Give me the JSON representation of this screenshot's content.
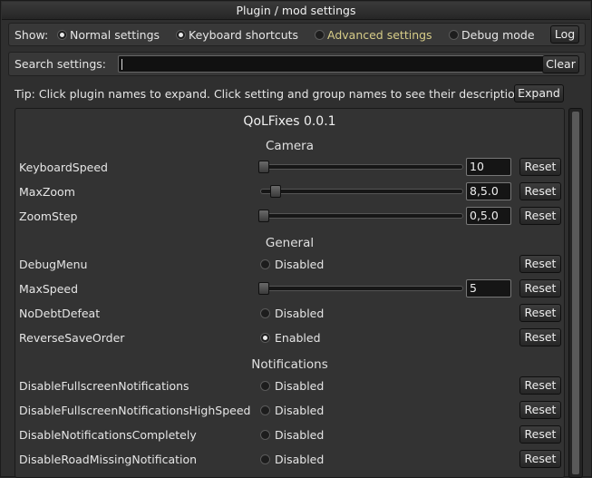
{
  "window": {
    "title": "Plugin / mod settings"
  },
  "filter": {
    "show_label": "Show:",
    "options": [
      {
        "label": "Normal settings",
        "selected": true
      },
      {
        "label": "Keyboard shortcuts",
        "selected": true
      },
      {
        "label": "Advanced settings",
        "selected": false
      },
      {
        "label": "Debug mode",
        "selected": false
      }
    ],
    "log_label": "Log"
  },
  "search": {
    "label": "Search settings:",
    "value": "",
    "clear_label": "Clear"
  },
  "tip": {
    "text": "Tip: Click plugin names to expand. Click setting and group names to see their descriptions.",
    "expand_label": "Expand"
  },
  "plugin": {
    "title": "QoLFixes 0.0.1",
    "reset_label": "Reset",
    "sections": [
      {
        "title": "Camera",
        "settings": [
          {
            "name": "KeyboardSpeed",
            "kind": "slider",
            "value": "10",
            "slider_fraction": 0.0
          },
          {
            "name": "MaxZoom",
            "kind": "slider",
            "value": "8,5.0",
            "slider_fraction": 0.06
          },
          {
            "name": "ZoomStep",
            "kind": "slider",
            "value": "0,5.0",
            "slider_fraction": 0.0
          }
        ]
      },
      {
        "title": "General",
        "settings": [
          {
            "name": "DebugMenu",
            "kind": "toggle",
            "enabled": false,
            "state_label": "Disabled"
          },
          {
            "name": "MaxSpeed",
            "kind": "slider",
            "value": "5",
            "slider_fraction": 0.0
          },
          {
            "name": "NoDebtDefeat",
            "kind": "toggle",
            "enabled": false,
            "state_label": "Disabled"
          },
          {
            "name": "ReverseSaveOrder",
            "kind": "toggle",
            "enabled": true,
            "state_label": "Enabled"
          }
        ]
      },
      {
        "title": "Notifications",
        "settings": [
          {
            "name": "DisableFullscreenNotifications",
            "kind": "toggle",
            "enabled": false,
            "state_label": "Disabled"
          },
          {
            "name": "DisableFullscreenNotificationsHighSpeed",
            "kind": "toggle",
            "enabled": false,
            "state_label": "Disabled"
          },
          {
            "name": "DisableNotificationsCompletely",
            "kind": "toggle",
            "enabled": false,
            "state_label": "Disabled"
          },
          {
            "name": "DisableRoadMissingNotification",
            "kind": "toggle",
            "enabled": false,
            "state_label": "Disabled"
          }
        ]
      }
    ]
  },
  "colors": {
    "accent_advanced": "#d7cd88",
    "background": "#2f2f2f"
  }
}
